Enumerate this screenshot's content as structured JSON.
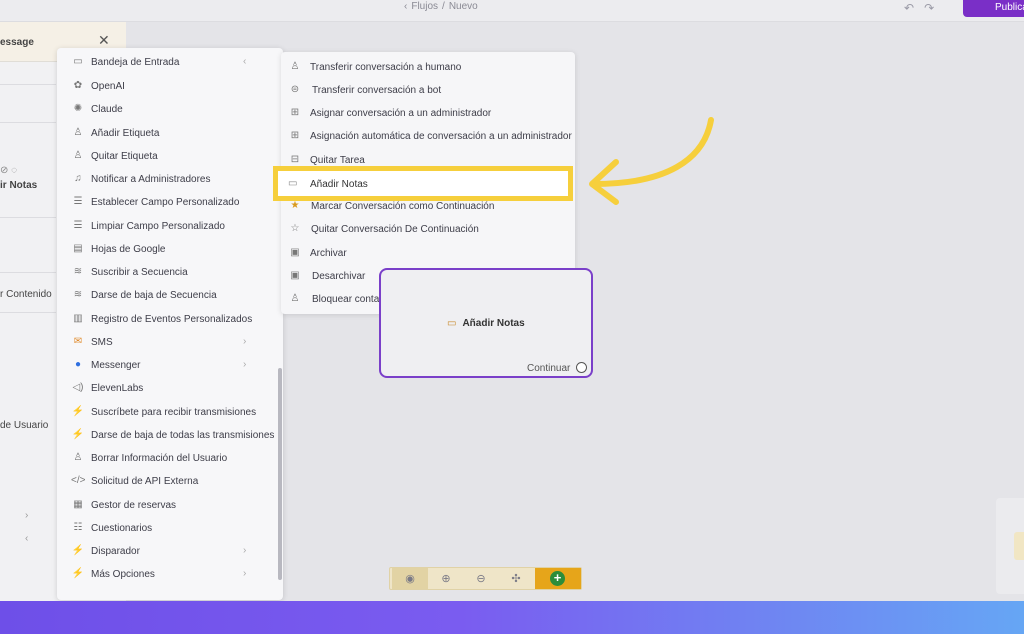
{
  "header": {
    "breadcrumb": [
      "Flujos",
      "Nuevo"
    ],
    "publish_label": "Publicar"
  },
  "left_panel": {
    "title": "essage",
    "texts": [
      "ir Notas",
      "r Contenido",
      "de Usuario"
    ]
  },
  "action_menu": {
    "items": [
      {
        "label": "Bandeja de Entrada",
        "icon": "inbox-icon"
      },
      {
        "label": "OpenAI",
        "icon": "openai-icon"
      },
      {
        "label": "Claude",
        "icon": "claude-icon"
      },
      {
        "label": "Añadir Etiqueta",
        "icon": "user-tag-icon"
      },
      {
        "label": "Quitar Etiqueta",
        "icon": "user-untag-icon"
      },
      {
        "label": "Notificar a Administradores",
        "icon": "bell-icon"
      },
      {
        "label": "Establecer Campo Personalizado",
        "icon": "database-icon"
      },
      {
        "label": "Limpiar Campo Personalizado",
        "icon": "database-clear-icon"
      },
      {
        "label": "Hojas de Google",
        "icon": "sheets-icon"
      },
      {
        "label": "Suscribir a Secuencia",
        "icon": "sequence-icon"
      },
      {
        "label": "Darse de baja de Secuencia",
        "icon": "sequence-unsubscribe-icon"
      },
      {
        "label": "Registro de Eventos Personalizados",
        "icon": "chart-icon"
      },
      {
        "label": "SMS",
        "icon": "sms-icon"
      },
      {
        "label": "Messenger",
        "icon": "messenger-icon"
      },
      {
        "label": "ElevenLabs",
        "icon": "audio-icon"
      },
      {
        "label": "Suscríbete para recibir transmisiones",
        "icon": "bolt-icon"
      },
      {
        "label": "Darse de baja de todas las transmisiones",
        "icon": "bolt-off-icon"
      },
      {
        "label": "Borrar Información del Usuario",
        "icon": "user-remove-icon"
      },
      {
        "label": "Solicitud de API Externa",
        "icon": "code-icon"
      },
      {
        "label": "Gestor de reservas",
        "icon": "calendar-icon"
      },
      {
        "label": "Cuestionarios",
        "icon": "quiz-icon"
      },
      {
        "label": "Disparador",
        "icon": "trigger-icon"
      },
      {
        "label": "Más Opciones",
        "icon": "more-options-icon"
      }
    ]
  },
  "inbox_submenu": {
    "items": [
      {
        "label": "Transferir conversación a humano",
        "icon": "person-icon"
      },
      {
        "label": "Transferir conversación a bot",
        "icon": "bot-icon"
      },
      {
        "label": "Asignar conversación a un administrador",
        "icon": "chat-plus-icon"
      },
      {
        "label": "Asignación automática de conversación a un administrador",
        "icon": "chat-auto-icon"
      },
      {
        "label": "Quitar Tarea",
        "icon": "remove-task-icon"
      },
      {
        "label": "Añadir Notas",
        "icon": "note-icon"
      },
      {
        "label": "Marcar Conversación como Continuación",
        "icon": "star-filled-icon"
      },
      {
        "label": "Quitar Conversación De Continuación",
        "icon": "star-outline-icon"
      },
      {
        "label": "Archivar",
        "icon": "archive-icon"
      },
      {
        "label": "Desarchivar",
        "icon": "unarchive-icon"
      },
      {
        "label": "Bloquear contacto",
        "icon": "block-contact-icon"
      }
    ]
  },
  "flow_node": {
    "title": "Añadir Notas",
    "continue_label": "Continuar"
  },
  "colors": {
    "accent": "#7a2fc7",
    "highlight": "#f6cf3c",
    "add_button": "#2c8d3a"
  }
}
